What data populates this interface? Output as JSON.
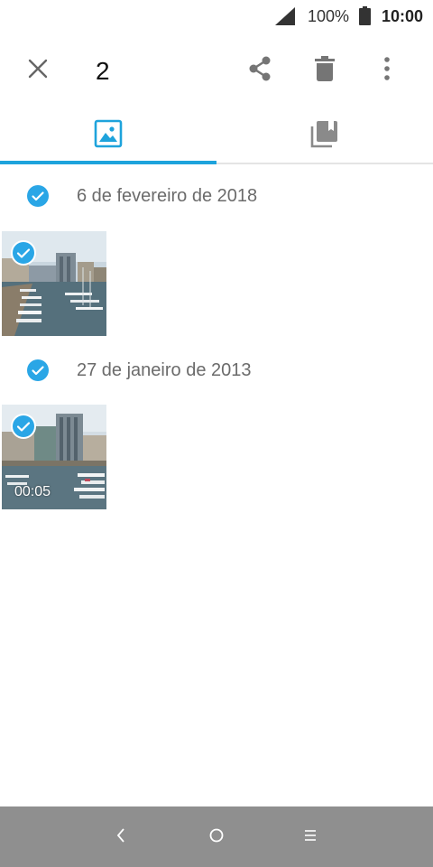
{
  "status_bar": {
    "battery_text": "100%",
    "time": "10:00",
    "icons": [
      "signal-icon",
      "battery-icon"
    ]
  },
  "toolbar": {
    "selected_count": "2",
    "icons": [
      "close-icon",
      "share-icon",
      "delete-icon",
      "more-vert-icon"
    ]
  },
  "tabs": [
    {
      "name": "photos",
      "icon": "image-icon",
      "active": true
    },
    {
      "name": "albums",
      "icon": "albums-icon",
      "active": false
    }
  ],
  "sections": [
    {
      "date": "6 de fevereiro de 2018",
      "selected": true,
      "items": [
        {
          "type": "photo",
          "selected": true
        }
      ]
    },
    {
      "date": "27 de janeiro de 2013",
      "selected": true,
      "items": [
        {
          "type": "video",
          "selected": true,
          "duration": "00:05"
        }
      ]
    }
  ],
  "nav_bar": {
    "icons": [
      "back-icon",
      "home-icon",
      "recents-icon"
    ]
  },
  "colors": {
    "accent": "#1ea3dc",
    "check_blue": "#2aa6e6",
    "icon_gray": "#757575",
    "nav_bar_bg": "#8f8f8f"
  }
}
